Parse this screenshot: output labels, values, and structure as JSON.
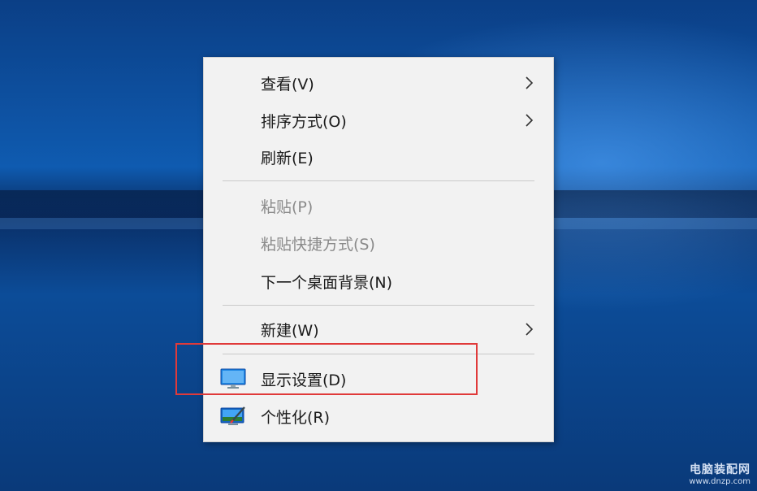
{
  "context_menu": {
    "items": [
      {
        "label": "查看(V)",
        "enabled": true,
        "submenu": true
      },
      {
        "label": "排序方式(O)",
        "enabled": true,
        "submenu": true
      },
      {
        "label": "刷新(E)",
        "enabled": true,
        "submenu": false
      },
      {
        "label": "粘贴(P)",
        "enabled": false,
        "submenu": false
      },
      {
        "label": "粘贴快捷方式(S)",
        "enabled": false,
        "submenu": false
      },
      {
        "label": "下一个桌面背景(N)",
        "enabled": true,
        "submenu": false
      },
      {
        "label": "新建(W)",
        "enabled": true,
        "submenu": true
      },
      {
        "label": "显示设置(D)",
        "enabled": true,
        "submenu": false,
        "icon": "display-settings-icon",
        "highlighted": true
      },
      {
        "label": "个性化(R)",
        "enabled": true,
        "submenu": false,
        "icon": "personalize-icon"
      }
    ]
  },
  "colors": {
    "highlight_box": "#e03a3a",
    "menu_background": "#f2f2f2",
    "disabled_text": "#8a8a8a"
  },
  "watermark": {
    "line1": "电脑装配网",
    "line2": "www.dnzp.com"
  }
}
